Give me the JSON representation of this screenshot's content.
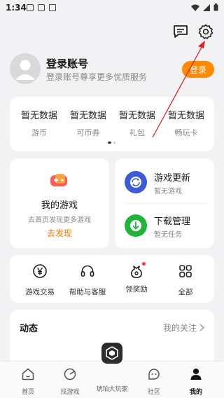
{
  "status_bar": {
    "time": "1:34"
  },
  "profile": {
    "title": "登录账号",
    "subtitle": "登录账号尊享更多优质服务",
    "login_button": "登录"
  },
  "stats": [
    {
      "value": "暂无数据",
      "label": "游币"
    },
    {
      "value": "暂无数据",
      "label": "可币券"
    },
    {
      "value": "暂无数据",
      "label": "礼包"
    },
    {
      "value": "暂无数据",
      "label": "畅玩卡"
    }
  ],
  "my_games": {
    "title": "我的游戏",
    "subtitle": "去首页发现更多游戏",
    "link": "去发现"
  },
  "updates": {
    "game_update_title": "游戏更新",
    "game_update_sub": "暂无游戏",
    "download_title": "下载管理",
    "download_sub": "暂无任务"
  },
  "actions": [
    {
      "label": "游戏交易",
      "icon": "yen-circle-icon"
    },
    {
      "label": "帮助与客服",
      "icon": "headset-icon"
    },
    {
      "label": "领奖励",
      "icon": "reward-bag-icon"
    },
    {
      "label": "全部",
      "icon": "grid-icon"
    }
  ],
  "feed": {
    "title": "动态",
    "link": "我的关注"
  },
  "bottom_nav": [
    {
      "label": "首页",
      "icon": "home-icon"
    },
    {
      "label": "找游戏",
      "icon": "find-game-icon"
    },
    {
      "label": "琥珀大玩家",
      "icon": "amber-logo-icon"
    },
    {
      "label": "社区",
      "icon": "community-icon"
    },
    {
      "label": "我的",
      "icon": "profile-icon"
    }
  ],
  "colors": {
    "accent_orange": "#ff8a00",
    "link_orange": "#f07800",
    "update_blue": "#3b5bdb",
    "download_green": "#1fb53a",
    "annotation_red": "#e02020"
  }
}
